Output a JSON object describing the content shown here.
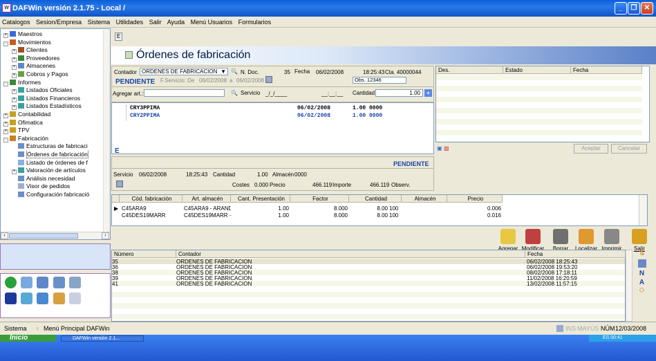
{
  "window": {
    "title": "DAFWin  versión 2.1.75 - Local  /"
  },
  "menu": [
    "Catalogos",
    "Sesion/Empresa",
    "Sistema",
    "Utilidades",
    "Salir",
    "Ayuda",
    "Menú Usuarios",
    "Formularios"
  ],
  "tree": [
    {
      "label": "Maestros",
      "level": 0,
      "exp": "+"
    },
    {
      "label": "Movimientos",
      "level": 0,
      "exp": "-"
    },
    {
      "label": "Clientes",
      "level": 1,
      "exp": "+"
    },
    {
      "label": "Proveedores",
      "level": 1,
      "exp": "+"
    },
    {
      "label": "Almacenes",
      "level": 1,
      "exp": "+"
    },
    {
      "label": "Cobros y Pagos",
      "level": 1,
      "exp": "+"
    },
    {
      "label": "Informes",
      "level": 0,
      "exp": "-"
    },
    {
      "label": "Listados Oficiales",
      "level": 1,
      "exp": "+"
    },
    {
      "label": "Listados Financieros",
      "level": 1,
      "exp": "+"
    },
    {
      "label": "Listados Estadísticos",
      "level": 1,
      "exp": "+"
    },
    {
      "label": "Contabilidad",
      "level": 0,
      "exp": "+"
    },
    {
      "label": "Ofimatica",
      "level": 0,
      "exp": "+"
    },
    {
      "label": "TPV",
      "level": 0,
      "exp": "+"
    },
    {
      "label": "Fabricación",
      "level": 0,
      "exp": "-"
    },
    {
      "label": "Estructuras de fabricaci",
      "level": 1,
      "exp": ""
    },
    {
      "label": "Órdenes de fabricación",
      "level": 1,
      "exp": ""
    },
    {
      "label": "Listado de órdenes de f",
      "level": 1,
      "exp": ""
    },
    {
      "label": "Valoración de artículos",
      "level": 1,
      "exp": "+"
    },
    {
      "label": "Análisis necesidad",
      "level": 1,
      "exp": ""
    },
    {
      "label": "Visor de pedidos",
      "level": 1,
      "exp": ""
    },
    {
      "label": "Configuración fabricació",
      "level": 1,
      "exp": ""
    }
  ],
  "header": {
    "toolbar_icon": "E",
    "title": "Órdenes de fabricación"
  },
  "form": {
    "contador_label": "Contador",
    "contador_value": "ORDENES DE FABRICACION",
    "ndoc_label": "N. Doc.",
    "ndoc_value": "35",
    "fecha_label": "Fecha",
    "fecha_value": "06/02/2008",
    "hora_value": "18:25:43",
    "cta_value": "Cta. 40000044",
    "estado": "PENDIENTE",
    "fservicio_label": "F.Servicio: De",
    "fservicio_de": "06/02/2008",
    "fservicio_a_label": "a",
    "fservicio_a": "06/02/2008",
    "obs": "Obs. 12346",
    "agregar_label": "Agregar art.:",
    "servicio_label": "Servicio",
    "servicio_value": "_/_/____",
    "servicio_hora": "__:__:__",
    "cantidad_label": "Cantidad",
    "cantidad_value": "1.00"
  },
  "items": [
    {
      "code": "CRY3PPIMA",
      "date": "06/02/2008",
      "qty": "1.00 0000",
      "color": "#000"
    },
    {
      "code": "CRY2PPIMA",
      "date": "06/02/2008",
      "qty": "1.00 0000",
      "color": "#1a44a8"
    }
  ],
  "right_grid": {
    "headers": [
      "Des.",
      "Estado",
      "Fecha"
    ],
    "aceptar": "Aceptar",
    "cancelar": "Cancelar"
  },
  "detail": {
    "estado": "PENDIENTE",
    "servicio_label": "Servicio",
    "servicio_value": "06/02/2008",
    "hora": "18:25:43",
    "cantidad_label": "Cantidad",
    "cantidad_value": "1.00",
    "almacen_label": "Almacén",
    "almacen_value": "0000",
    "costes_label": "Costes",
    "costes_value": "0.000",
    "precio_label": "Precio",
    "precio_value": "466.119",
    "importe_label": "Importe",
    "importe_value": "466.119",
    "observ_label": "Observ."
  },
  "components": {
    "headers": [
      "Cód. fabricación",
      "Art. almacén",
      "Cant. Presentación",
      "Factor",
      "Cantidad",
      "Almacén",
      "Precio"
    ],
    "rows": [
      [
        "C45ARA9",
        "C45ARA9 - ARANDE",
        "1.00",
        "8.000",
        "8.00",
        "100",
        "0.006"
      ],
      [
        "C45DES19MARR",
        "C45DES19MARR - [",
        "1.00",
        "8.000",
        "8.00",
        "100",
        "0.016"
      ]
    ]
  },
  "actions": [
    "Agregar",
    "Modificar",
    "Borrar",
    "Localizar",
    "Imprimir",
    "Salir"
  ],
  "list": {
    "headers": [
      "Número",
      "Contador",
      "Fecha"
    ],
    "rows": [
      [
        "35",
        "ORDENES DE FABRICACION",
        "06/02/2008 18:25:43"
      ],
      [
        "36",
        "ORDENES DE FABRICACION",
        "06/02/2008 19:53:20"
      ],
      [
        "38",
        "ORDENES DE FABRICACION",
        "08/02/2008 17:18:11"
      ],
      [
        "39",
        "ORDENES DE FABRICACION",
        "11/02/2008 16:20:59"
      ],
      [
        "41",
        "ORDENES DE FABRICACION",
        "13/02/2008 11:57:15"
      ]
    ]
  },
  "side_letters": [
    "N",
    "A"
  ],
  "status": {
    "left": "Sistema",
    "menu": "Menú Principal DAFWin",
    "ins": "INS",
    "mayus": "MAYÚS",
    "num": "NÚM",
    "date": "12/03/2008"
  },
  "taskbar": {
    "start": "Inicio",
    "task": "DAFWin versión 2.1...",
    "tray": "ES  00:41"
  }
}
